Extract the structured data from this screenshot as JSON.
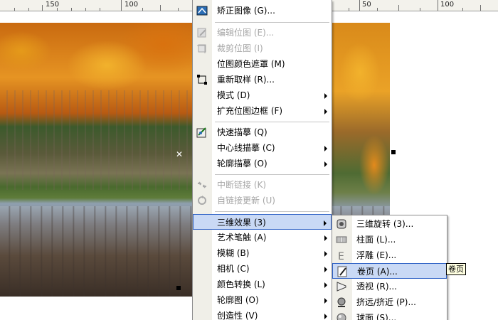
{
  "ruler": {
    "labels": [
      "150",
      "100",
      "50",
      "100"
    ]
  },
  "main_menu": {
    "items": [
      {
        "label": "矫正图像 (G)...",
        "enabled": true,
        "icon": "straighten-image-icon"
      },
      {
        "label": "编辑位图 (E)...",
        "enabled": false,
        "icon": "edit-bitmap-icon"
      },
      {
        "label": "裁剪位图 (I)",
        "enabled": false,
        "icon": "crop-bitmap-icon"
      },
      {
        "label": "位图颜色遮罩 (M)",
        "enabled": true,
        "icon": ""
      },
      {
        "label": "重新取样 (R)...",
        "enabled": true,
        "icon": "resample-icon"
      },
      {
        "label": "模式 (D)",
        "enabled": true,
        "submenu": true
      },
      {
        "label": "扩充位图边框 (F)",
        "enabled": true,
        "submenu": true
      },
      {
        "label": "快速描摹 (Q)",
        "enabled": true,
        "icon": "quick-trace-icon"
      },
      {
        "label": "中心线描摹 (C)",
        "enabled": true,
        "submenu": true
      },
      {
        "label": "轮廓描摹 (O)",
        "enabled": true,
        "submenu": true
      },
      {
        "label": "中断链接 (K)",
        "enabled": false,
        "icon": "break-link-icon"
      },
      {
        "label": "自链接更新 (U)",
        "enabled": false,
        "icon": "update-link-icon"
      },
      {
        "label": "三维效果 (3)",
        "enabled": true,
        "submenu": true,
        "highlighted": true
      },
      {
        "label": "艺术笔触 (A)",
        "enabled": true,
        "submenu": true
      },
      {
        "label": "模糊 (B)",
        "enabled": true,
        "submenu": true
      },
      {
        "label": "相机 (C)",
        "enabled": true,
        "submenu": true
      },
      {
        "label": "颜色转换 (L)",
        "enabled": true,
        "submenu": true
      },
      {
        "label": "轮廓图 (O)",
        "enabled": true,
        "submenu": true
      },
      {
        "label": "创造性 (V)",
        "enabled": true,
        "submenu": true
      }
    ]
  },
  "sub_menu": {
    "items": [
      {
        "label": "三维旋转 (3)...",
        "icon": "3d-rotate-icon"
      },
      {
        "label": "柱面 (L)...",
        "icon": "cylinder-icon"
      },
      {
        "label": "浮雕 (E)...",
        "icon": "emboss-icon"
      },
      {
        "label": "卷页 (A)...",
        "icon": "page-curl-icon",
        "highlighted": true
      },
      {
        "label": "透视 (R)...",
        "icon": "perspective-icon"
      },
      {
        "label": "挤远/挤近 (P)...",
        "icon": "pinch-punch-icon"
      },
      {
        "label": "球面 (S)...",
        "icon": "sphere-icon"
      }
    ]
  },
  "tooltip": {
    "text": "卷页"
  },
  "colors": {
    "highlight_bg": "#c9d9f5",
    "highlight_border": "#3163c6",
    "disabled_text": "#a6a6a6",
    "gutter": "#f0efe8"
  }
}
